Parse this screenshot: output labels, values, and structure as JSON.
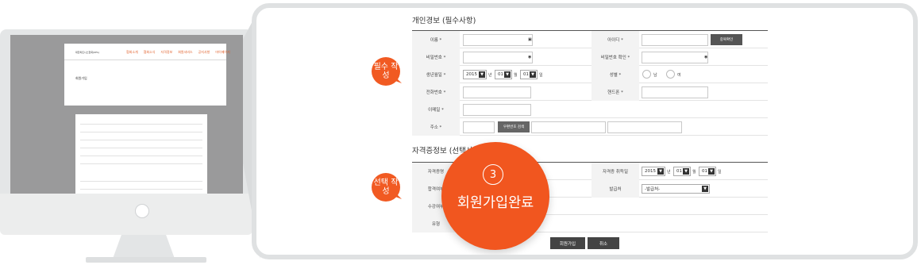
{
  "monitor": {
    "site_logo": "대한피트니스협회(KFA)",
    "nav": [
      "협회소개",
      "협회소식",
      "자격정보",
      "회원서비스",
      "공지사항",
      "마이페이지"
    ],
    "page_title": "회원가입"
  },
  "personal": {
    "title": "개인경보 (필수사항)",
    "name_label": "이름 *",
    "id_label": "아이디 *",
    "id_check_button": "중복확인",
    "pw_label": "비밀번호 *",
    "pw_confirm_label": "비밀번호 확인 *",
    "birth_label": "생년월일 *",
    "birth_year": "2015",
    "birth_month": "01",
    "birth_day": "01",
    "year_unit": "년",
    "month_unit": "월",
    "day_unit": "일",
    "gender_label": "성별 *",
    "gender_male": "남",
    "gender_female": "여",
    "phone_label": "전화번호 *",
    "mobile_label": "핸드폰 *",
    "email_label": "이메일 *",
    "address_label": "주소 *",
    "zip_button": "우편번호 검색"
  },
  "badges": {
    "required": "필수 작성",
    "optional": "선택 작성"
  },
  "qualification": {
    "title": "자격증정보 (선택사항)",
    "cert_label": "자격증명",
    "acquired_date_label": "자격증 취득일",
    "acq_year": "2015",
    "acq_month": "01",
    "acq_day": "01",
    "pass_label": "합격여부",
    "issuer_label": "발급처",
    "issuer_select": "-발급처-",
    "course_label": "수강여부",
    "type_label": "유형"
  },
  "step": {
    "number": "3",
    "label": "회원가입완료"
  },
  "actions": {
    "join": "회원가입",
    "cancel": "취소"
  },
  "colors": {
    "accent": "#f15a22",
    "button": "#444444"
  }
}
